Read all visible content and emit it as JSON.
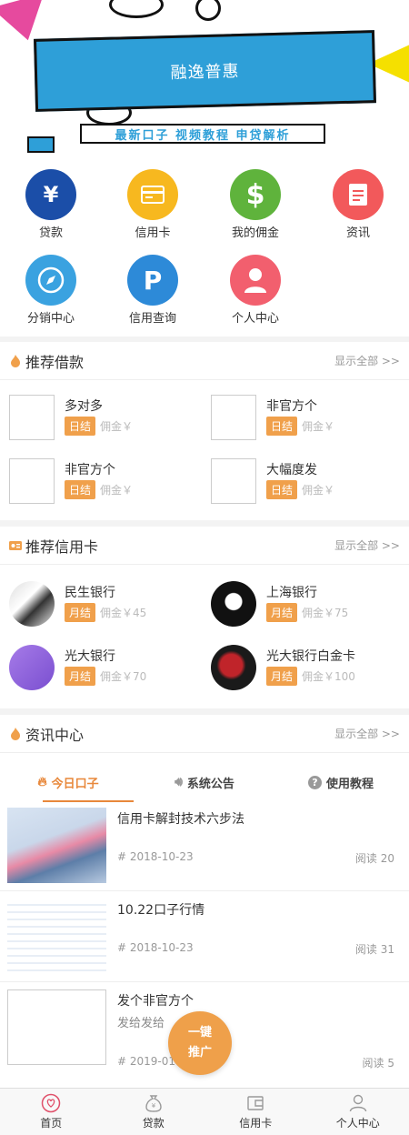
{
  "banner": {
    "title": "融逸普惠",
    "strip": "最新口子 视频教程 申贷解析"
  },
  "grid": [
    {
      "label": "贷款",
      "icon": "yen-icon",
      "color": "#1b4ea8",
      "glyph": "¥"
    },
    {
      "label": "信用卡",
      "icon": "credit-card-icon",
      "color": "#f7b81f",
      "glyph": "▭"
    },
    {
      "label": "我的佣金",
      "icon": "dollar-icon",
      "color": "#5fb33c",
      "glyph": "$"
    },
    {
      "label": "资讯",
      "icon": "document-icon",
      "color": "#f2595b",
      "glyph": "▤"
    },
    {
      "label": "分销中心",
      "icon": "compass-icon",
      "color": "#3aa2e0",
      "glyph": "➤"
    },
    {
      "label": "信用查询",
      "icon": "p-icon",
      "color": "#2d8ad8",
      "glyph": "P"
    },
    {
      "label": "个人中心",
      "icon": "user-icon",
      "color": "#f25f6e",
      "glyph": "●"
    }
  ],
  "loans": {
    "title": "推荐借款",
    "more": "显示全部 >>",
    "items": [
      {
        "name": "多对多",
        "tag": "日结",
        "commission": "佣金￥"
      },
      {
        "name": "非官方个",
        "tag": "日结",
        "commission": "佣金￥"
      },
      {
        "name": "非官方个",
        "tag": "日结",
        "commission": "佣金￥"
      },
      {
        "name": "大幅度发",
        "tag": "日结",
        "commission": "佣金￥"
      }
    ]
  },
  "cards": {
    "title": "推荐信用卡",
    "more": "显示全部 >>",
    "items": [
      {
        "name": "民生银行",
        "tag": "月结",
        "commission": "佣金￥45"
      },
      {
        "name": "上海银行",
        "tag": "月结",
        "commission": "佣金￥75"
      },
      {
        "name": "光大银行",
        "tag": "月结",
        "commission": "佣金￥70"
      },
      {
        "name": "光大银行白金卡",
        "tag": "月结",
        "commission": "佣金￥100"
      }
    ]
  },
  "news": {
    "title": "资讯中心",
    "more": "显示全部 >>",
    "tabs": [
      {
        "label": "今日口子",
        "icon": "flame-icon"
      },
      {
        "label": "系统公告",
        "icon": "speaker-icon"
      },
      {
        "label": "使用教程",
        "icon": "question-icon"
      }
    ],
    "items": [
      {
        "title": "信用卡解封技术六步法",
        "sub": "",
        "date": "#  2018-10-23",
        "reads": "阅读  20"
      },
      {
        "title": "10.22口子行情",
        "sub": "",
        "date": "#  2018-10-23",
        "reads": "阅读  31"
      },
      {
        "title": "发个非官方个",
        "sub": "发给发给",
        "date": "#  2019-01",
        "reads": "阅读  5"
      }
    ]
  },
  "fab": {
    "line1": "一键",
    "line2": "推广"
  },
  "bottom_nav": [
    {
      "label": "首页",
      "icon": "home-icon"
    },
    {
      "label": "贷款",
      "icon": "money-bag-icon"
    },
    {
      "label": "信用卡",
      "icon": "wallet-icon"
    },
    {
      "label": "个人中心",
      "icon": "user-icon"
    }
  ],
  "colors": {
    "accent": "#e8883b",
    "tag": "#f0a04b"
  }
}
